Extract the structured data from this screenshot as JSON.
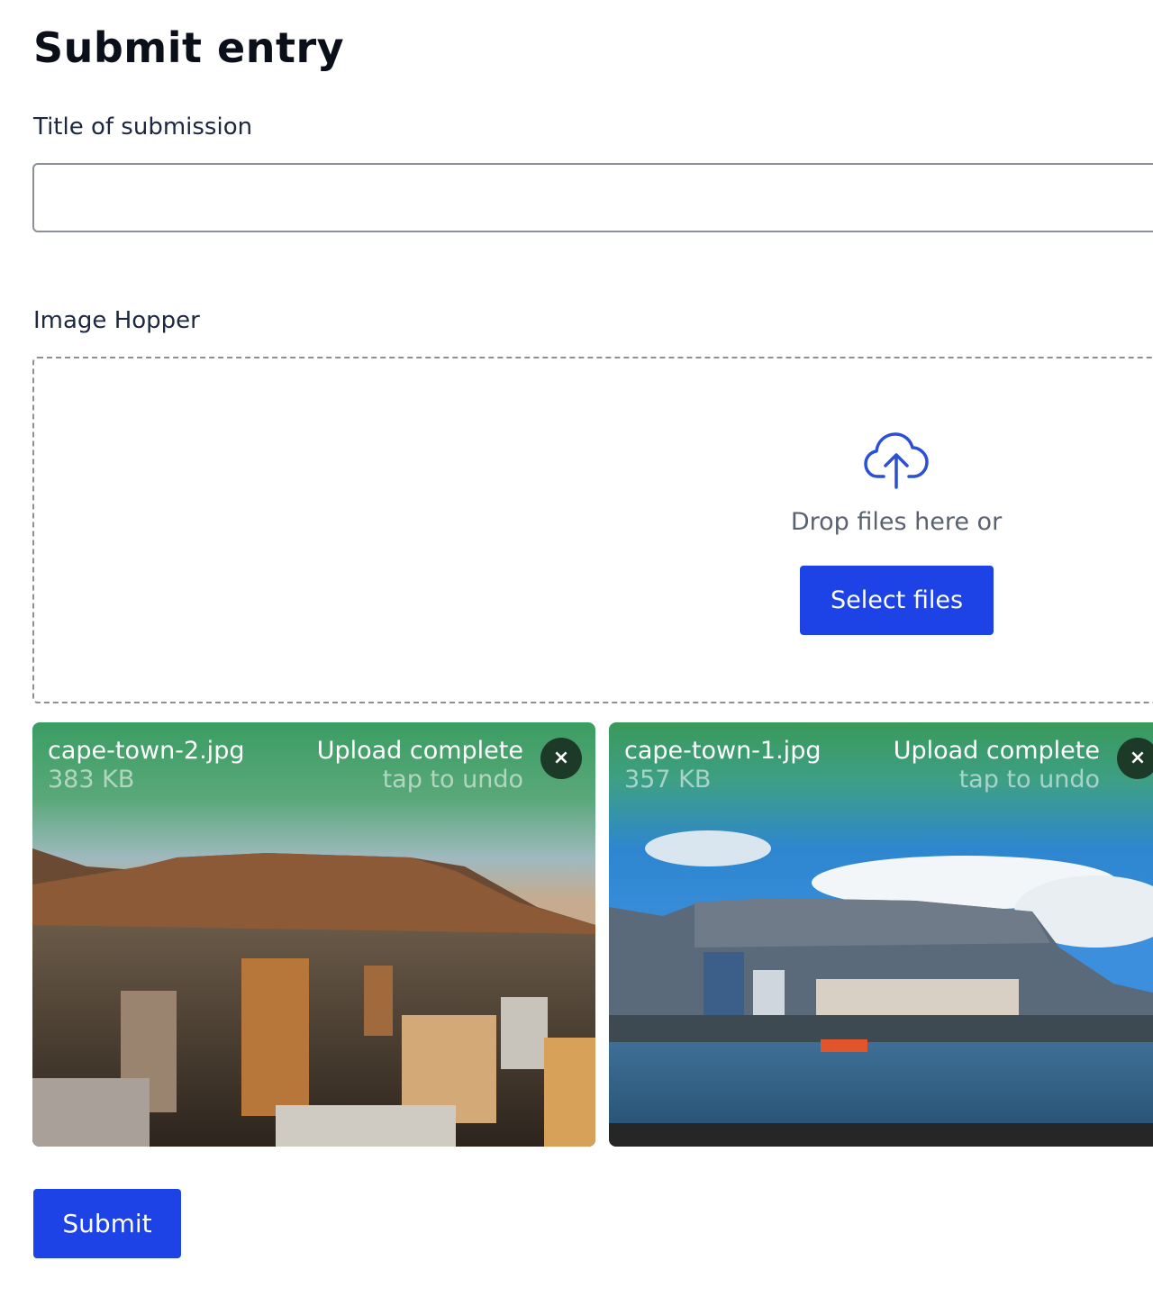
{
  "page": {
    "title": "Submit entry"
  },
  "form": {
    "title_label": "Title of submission",
    "title_value": "",
    "hopper_label": "Image Hopper",
    "submit_label": "Submit"
  },
  "dropzone": {
    "icon": "cloud-upload-icon",
    "prompt": "Drop files here or",
    "select_label": "Select files"
  },
  "files": [
    {
      "name": "cape-town-2.jpg",
      "size": "383 KB",
      "status": "Upload complete",
      "hint": "tap to undo",
      "remove_label": "×"
    },
    {
      "name": "cape-town-1.jpg",
      "size": "357 KB",
      "status": "Upload complete",
      "hint": "tap to undo",
      "remove_label": "×"
    }
  ],
  "colors": {
    "primary": "#1d43e6",
    "success": "#3a9a5a",
    "remove_bg": "#1d3a29"
  }
}
